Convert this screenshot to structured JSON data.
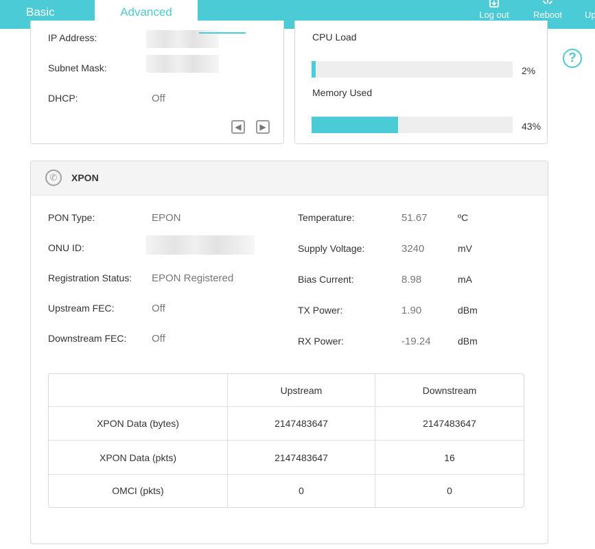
{
  "nav": {
    "tab_basic": "Basic",
    "tab_advanced": "Advanced",
    "logout": "Log out",
    "reboot": "Reboot",
    "upgrade_partial": "Up"
  },
  "colors": {
    "accent": "#4acbd6"
  },
  "left_panel": {
    "ip_label": "IP Address:",
    "subnet_label": "Subnet Mask:",
    "dhcp_label": "DHCP:",
    "dhcp_value": "Off"
  },
  "right_panel": {
    "cpu_label": "CPU Load",
    "cpu_percent_text": "2%",
    "cpu_fraction": 0.02,
    "mem_label": "Memory Used",
    "mem_percent_text": "43%",
    "mem_fraction": 0.43
  },
  "xpon": {
    "title": "XPON",
    "pon_type_label": "PON Type:",
    "pon_type_value": "EPON",
    "onu_id_label": "ONU ID:",
    "reg_status_label": "Registration Status:",
    "reg_status_value": "EPON Registered",
    "up_fec_label": "Upstream FEC:",
    "up_fec_value": "Off",
    "down_fec_label": "Downstream FEC:",
    "down_fec_value": "Off",
    "temp_label": "Temperature:",
    "temp_value": "51.67",
    "temp_unit": "ºC",
    "voltage_label": "Supply Voltage:",
    "voltage_value": "3240",
    "voltage_unit": "mV",
    "bias_label": "Bias Current:",
    "bias_value": "8.98",
    "bias_unit": "mA",
    "tx_label": "TX Power:",
    "tx_value": "1.90",
    "tx_unit": "dBm",
    "rx_label": "RX Power:",
    "rx_value": "-19.24",
    "rx_unit": "dBm"
  },
  "table": {
    "headers": [
      "",
      "Upstream",
      "Downstream"
    ],
    "rows": [
      [
        "XPON Data (bytes)",
        "2147483647",
        "2147483647"
      ],
      [
        "XPON Data (pkts)",
        "2147483647",
        "16"
      ],
      [
        "OMCI (pkts)",
        "0",
        "0"
      ]
    ]
  }
}
